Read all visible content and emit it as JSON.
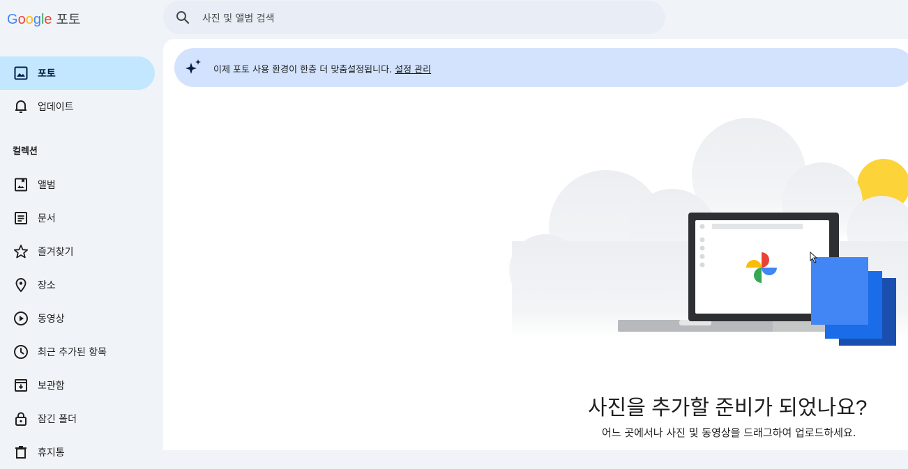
{
  "header": {
    "logo_letters": [
      "G",
      "o",
      "o",
      "g",
      "l",
      "e"
    ],
    "product": "포토",
    "search_placeholder": "사진 및 앨범 검색"
  },
  "sidebar": {
    "items": [
      {
        "label": "포토",
        "icon": "photo-icon",
        "active": true
      },
      {
        "label": "업데이트",
        "icon": "bell-icon"
      }
    ],
    "collections_label": "컬렉션",
    "collections": [
      {
        "label": "앨범",
        "icon": "album-icon"
      },
      {
        "label": "문서",
        "icon": "document-icon"
      },
      {
        "label": "즐겨찾기",
        "icon": "star-icon"
      },
      {
        "label": "장소",
        "icon": "location-pin-icon"
      },
      {
        "label": "동영상",
        "icon": "play-circle-icon"
      },
      {
        "label": "최근 추가된 항목",
        "icon": "clock-icon"
      },
      {
        "label": "보관함",
        "icon": "archive-icon"
      },
      {
        "label": "잠긴 폴더",
        "icon": "lock-icon"
      },
      {
        "label": "휴지통",
        "icon": "trash-icon"
      }
    ]
  },
  "banner": {
    "text": "이제 포토 사용 환경이 한층 더 맞춤설정됩니다.",
    "link": "설정 관리",
    "icon": "sparkle-icon"
  },
  "empty_state": {
    "headline": "사진을 추가할 준비가 되었나요?",
    "subtext": "어느 곳에서나 사진 및 동영상을 드래그하여 업로드하세요."
  },
  "colors": {
    "background": "#f0f4f9",
    "active_nav": "#c2e7ff",
    "banner": "#d3e3fd",
    "search": "#e9eef6",
    "accent_blue": "#4285f4"
  }
}
